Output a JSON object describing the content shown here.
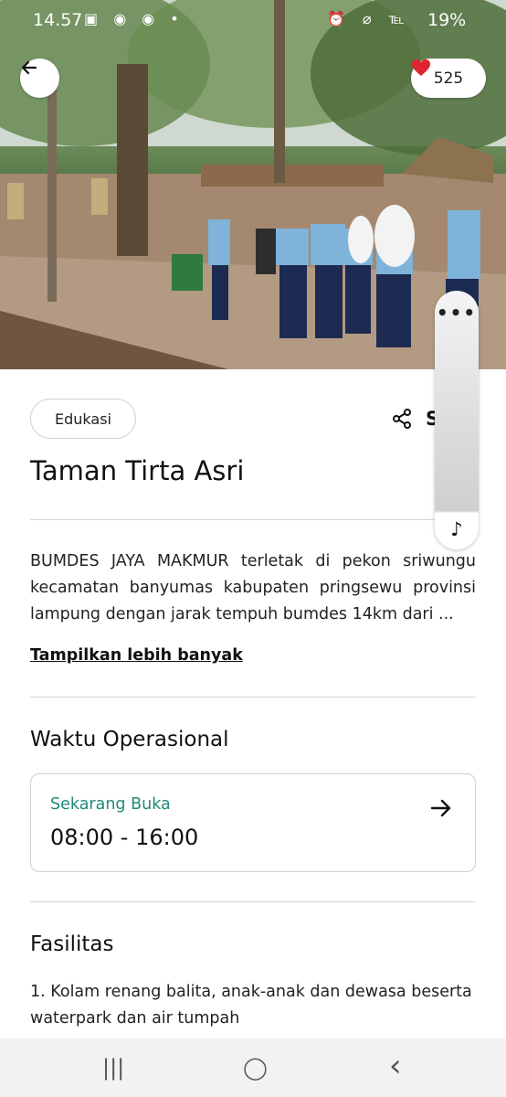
{
  "status_bar": {
    "time": "14.57",
    "left_icons": "▣ ◉ ◉ •",
    "right_icons": "⏰ ⌀ ℡",
    "battery": "19%"
  },
  "header": {
    "back_icon": "arrow-left-icon",
    "like_count": "525",
    "heart_color": "#e0242f"
  },
  "place": {
    "category": "Edukasi",
    "share_label": "S",
    "title": "Taman Tirta Asri",
    "description": "BUMDES JAYA MAKMUR terletak di pekon sriwungu kecamatan banyumas kabupaten pringsewu provinsi lampung dengan jarak tempuh bumdes 14km dari ...",
    "show_more": "Tampilkan lebih banyak"
  },
  "hours_section": {
    "title": "Waktu Operasional",
    "status": "Sekarang Buka",
    "hours": "08:00 - 16:00",
    "status_color": "#1f8a7a"
  },
  "facilities_section": {
    "title": "Fasilitas",
    "first_item": "1. Kolam renang balita, anak-anak dan dewasa beserta waterpark dan air tumpah"
  },
  "side_panel": {
    "menu_label": "•••",
    "music_icon": "♪"
  },
  "nav": {
    "recents": "|||",
    "home": "◯",
    "back": "‹"
  }
}
